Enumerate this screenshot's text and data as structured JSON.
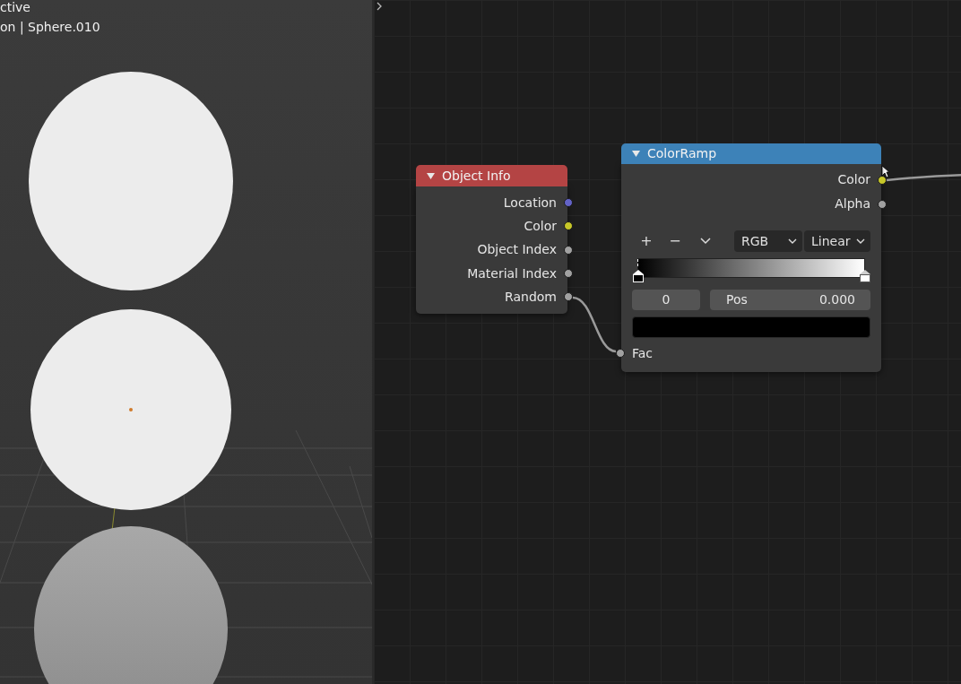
{
  "viewport": {
    "overlay_text": [
      "ctive",
      "on | Sphere.010"
    ]
  },
  "node_editor": {
    "nodes": [
      {
        "kind": "object_info",
        "title": "Object Info",
        "expanded": true,
        "color": "#b44444",
        "outputs": [
          {
            "label": "Location",
            "color": "#6363c7"
          },
          {
            "label": "Color",
            "color": "#c7c729"
          },
          {
            "label": "Object Index",
            "color": "#a1a1a1"
          },
          {
            "label": "Material Index",
            "color": "#a1a1a1"
          },
          {
            "label": "Random",
            "color": "#a1a1a1"
          }
        ]
      },
      {
        "kind": "color_ramp",
        "title": "ColorRamp",
        "expanded": true,
        "color": "#3d82b8",
        "outputs": [
          {
            "label": "Color",
            "color": "#c7c729"
          },
          {
            "label": "Alpha",
            "color": "#a1a1a1"
          }
        ],
        "tools": [
          "+",
          "−"
        ],
        "color_mode": "RGB",
        "interpolation": "Linear",
        "stops": [
          {
            "color": "#000000",
            "selected": true
          },
          {
            "color": "#ffffff",
            "selected": false
          }
        ],
        "stop_index": "0",
        "pos_label": "Pos",
        "pos_value": "0.000",
        "inputs": [
          {
            "label": "Fac",
            "color": "#a1a1a1"
          }
        ]
      }
    ]
  }
}
